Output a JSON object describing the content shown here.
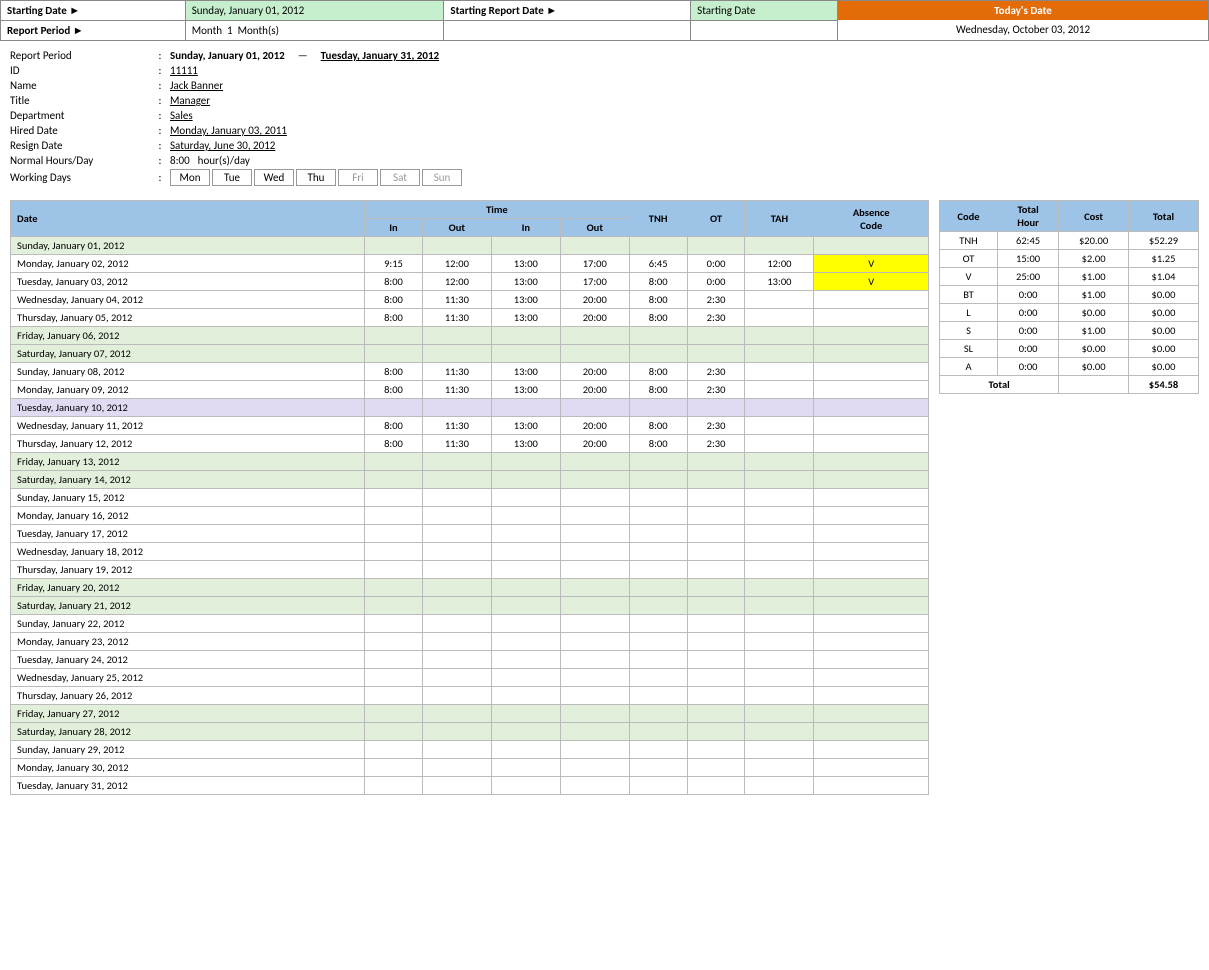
{
  "header": {
    "starting_date_label": "Starting Date ►",
    "starting_date_value": "Sunday, January 01, 2012",
    "starting_report_date_label": "Starting Report Date ►",
    "starting_report_date_value": "Starting Date",
    "report_period_label": "Report Period ►",
    "report_period_month": "Month",
    "report_period_num": "1",
    "report_period_unit": "Month(s)",
    "todays_date_header": "Today's Date",
    "todays_date_value": "Wednesday, October 03, 2012"
  },
  "info": {
    "report_period_label": "Report Period",
    "report_period_start": "Sunday, January 01, 2012",
    "report_period_end": "Tuesday, January 31, 2012",
    "id_label": "ID",
    "id_value": "11111",
    "name_label": "Name",
    "name_value": "Jack Banner",
    "title_label": "Title",
    "title_value": "Manager",
    "department_label": "Department",
    "department_value": "Sales",
    "hired_date_label": "Hired Date",
    "hired_date_value": "Monday, January 03, 2011",
    "resign_date_label": "Resign Date",
    "resign_date_value": "Saturday, June 30, 2012",
    "normal_hours_label": "Normal Hours/Day",
    "normal_hours_value": "8:00",
    "normal_hours_unit": "hour(s)/day",
    "working_days_label": "Working Days",
    "working_days": [
      "Mon",
      "Tue",
      "Wed",
      "Thu",
      "Fri",
      "Sat",
      "Sun"
    ],
    "working_days_active": [
      true,
      true,
      true,
      true,
      false,
      false,
      false
    ]
  },
  "table": {
    "headers": {
      "date": "Date",
      "time": "Time",
      "tnh": "TNH",
      "ot": "OT",
      "tah": "TAH",
      "absence_code": "Absence Code",
      "time_in1": "In",
      "time_out1": "Out",
      "time_in2": "In",
      "time_out2": "Out"
    },
    "rows": [
      {
        "date": "Sunday, January 01, 2012",
        "type": "sunday",
        "in1": "",
        "out1": "",
        "in2": "",
        "out2": "",
        "tnh": "",
        "ot": "",
        "tah": "",
        "absence": ""
      },
      {
        "date": "Monday, January 02, 2012",
        "type": "normal",
        "in1": "9:15",
        "out1": "12:00",
        "in2": "13:00",
        "out2": "17:00",
        "tnh": "6:45",
        "ot": "0:00",
        "tah": "12:00",
        "absence": "V",
        "absence_yellow": true
      },
      {
        "date": "Tuesday, January 03, 2012",
        "type": "normal",
        "in1": "8:00",
        "out1": "12:00",
        "in2": "13:00",
        "out2": "17:00",
        "tnh": "8:00",
        "ot": "0:00",
        "tah": "13:00",
        "absence": "V",
        "absence_yellow": true
      },
      {
        "date": "Wednesday, January 04, 2012",
        "type": "normal",
        "in1": "8:00",
        "out1": "11:30",
        "in2": "13:00",
        "out2": "20:00",
        "tnh": "8:00",
        "ot": "2:30",
        "tah": "",
        "absence": ""
      },
      {
        "date": "Thursday, January 05, 2012",
        "type": "normal",
        "in1": "8:00",
        "out1": "11:30",
        "in2": "13:00",
        "out2": "20:00",
        "tnh": "8:00",
        "ot": "2:30",
        "tah": "",
        "absence": ""
      },
      {
        "date": "Friday, January 06, 2012",
        "type": "saturday",
        "in1": "",
        "out1": "",
        "in2": "",
        "out2": "",
        "tnh": "",
        "ot": "",
        "tah": "",
        "absence": ""
      },
      {
        "date": "Saturday, January 07, 2012",
        "type": "saturday",
        "in1": "",
        "out1": "",
        "in2": "",
        "out2": "",
        "tnh": "",
        "ot": "",
        "tah": "",
        "absence": ""
      },
      {
        "date": "Sunday, January 08, 2012",
        "type": "normal",
        "in1": "8:00",
        "out1": "11:30",
        "in2": "13:00",
        "out2": "20:00",
        "tnh": "8:00",
        "ot": "2:30",
        "tah": "",
        "absence": ""
      },
      {
        "date": "Monday, January 09, 2012",
        "type": "normal",
        "in1": "8:00",
        "out1": "11:30",
        "in2": "13:00",
        "out2": "20:00",
        "tnh": "8:00",
        "ot": "2:30",
        "tah": "",
        "absence": ""
      },
      {
        "date": "Tuesday, January 10, 2012",
        "type": "special",
        "in1": "",
        "out1": "",
        "in2": "",
        "out2": "",
        "tnh": "",
        "ot": "",
        "tah": "",
        "absence": ""
      },
      {
        "date": "Wednesday, January 11, 2012",
        "type": "normal",
        "in1": "8:00",
        "out1": "11:30",
        "in2": "13:00",
        "out2": "20:00",
        "tnh": "8:00",
        "ot": "2:30",
        "tah": "",
        "absence": ""
      },
      {
        "date": "Thursday, January 12, 2012",
        "type": "normal",
        "in1": "8:00",
        "out1": "11:30",
        "in2": "13:00",
        "out2": "20:00",
        "tnh": "8:00",
        "ot": "2:30",
        "tah": "",
        "absence": ""
      },
      {
        "date": "Friday, January 13, 2012",
        "type": "saturday",
        "in1": "",
        "out1": "",
        "in2": "",
        "out2": "",
        "tnh": "",
        "ot": "",
        "tah": "",
        "absence": ""
      },
      {
        "date": "Saturday, January 14, 2012",
        "type": "saturday",
        "in1": "",
        "out1": "",
        "in2": "",
        "out2": "",
        "tnh": "",
        "ot": "",
        "tah": "",
        "absence": ""
      },
      {
        "date": "Sunday, January 15, 2012",
        "type": "normal",
        "in1": "",
        "out1": "",
        "in2": "",
        "out2": "",
        "tnh": "",
        "ot": "",
        "tah": "",
        "absence": ""
      },
      {
        "date": "Monday, January 16, 2012",
        "type": "normal",
        "in1": "",
        "out1": "",
        "in2": "",
        "out2": "",
        "tnh": "",
        "ot": "",
        "tah": "",
        "absence": ""
      },
      {
        "date": "Tuesday, January 17, 2012",
        "type": "normal",
        "in1": "",
        "out1": "",
        "in2": "",
        "out2": "",
        "tnh": "",
        "ot": "",
        "tah": "",
        "absence": ""
      },
      {
        "date": "Wednesday, January 18, 2012",
        "type": "normal",
        "in1": "",
        "out1": "",
        "in2": "",
        "out2": "",
        "tnh": "",
        "ot": "",
        "tah": "",
        "absence": ""
      },
      {
        "date": "Thursday, January 19, 2012",
        "type": "normal",
        "in1": "",
        "out1": "",
        "in2": "",
        "out2": "",
        "tnh": "",
        "ot": "",
        "tah": "",
        "absence": ""
      },
      {
        "date": "Friday, January 20, 2012",
        "type": "saturday",
        "in1": "",
        "out1": "",
        "in2": "",
        "out2": "",
        "tnh": "",
        "ot": "",
        "tah": "",
        "absence": ""
      },
      {
        "date": "Saturday, January 21, 2012",
        "type": "saturday",
        "in1": "",
        "out1": "",
        "in2": "",
        "out2": "",
        "tnh": "",
        "ot": "",
        "tah": "",
        "absence": ""
      },
      {
        "date": "Sunday, January 22, 2012",
        "type": "normal",
        "in1": "",
        "out1": "",
        "in2": "",
        "out2": "",
        "tnh": "",
        "ot": "",
        "tah": "",
        "absence": ""
      },
      {
        "date": "Monday, January 23, 2012",
        "type": "normal",
        "in1": "",
        "out1": "",
        "in2": "",
        "out2": "",
        "tnh": "",
        "ot": "",
        "tah": "",
        "absence": ""
      },
      {
        "date": "Tuesday, January 24, 2012",
        "type": "normal",
        "in1": "",
        "out1": "",
        "in2": "",
        "out2": "",
        "tnh": "",
        "ot": "",
        "tah": "",
        "absence": ""
      },
      {
        "date": "Wednesday, January 25, 2012",
        "type": "normal",
        "in1": "",
        "out1": "",
        "in2": "",
        "out2": "",
        "tnh": "",
        "ot": "",
        "tah": "",
        "absence": ""
      },
      {
        "date": "Thursday, January 26, 2012",
        "type": "normal",
        "in1": "",
        "out1": "",
        "in2": "",
        "out2": "",
        "tnh": "",
        "ot": "",
        "tah": "",
        "absence": ""
      },
      {
        "date": "Friday, January 27, 2012",
        "type": "saturday",
        "in1": "",
        "out1": "",
        "in2": "",
        "out2": "",
        "tnh": "",
        "ot": "",
        "tah": "",
        "absence": ""
      },
      {
        "date": "Saturday, January 28, 2012",
        "type": "saturday",
        "in1": "",
        "out1": "",
        "in2": "",
        "out2": "",
        "tnh": "",
        "ot": "",
        "tah": "",
        "absence": ""
      },
      {
        "date": "Sunday, January 29, 2012",
        "type": "normal",
        "in1": "",
        "out1": "",
        "in2": "",
        "out2": "",
        "tnh": "",
        "ot": "",
        "tah": "",
        "absence": ""
      },
      {
        "date": "Monday, January 30, 2012",
        "type": "normal",
        "in1": "",
        "out1": "",
        "in2": "",
        "out2": "",
        "tnh": "",
        "ot": "",
        "tah": "",
        "absence": ""
      },
      {
        "date": "Tuesday, January 31, 2012",
        "type": "normal",
        "in1": "",
        "out1": "",
        "in2": "",
        "out2": "",
        "tnh": "",
        "ot": "",
        "tah": "",
        "absence": ""
      }
    ]
  },
  "summary": {
    "headers": [
      "Code",
      "Total Hour",
      "Cost",
      "Total"
    ],
    "rows": [
      {
        "code": "TNH",
        "total_hour": "62:45",
        "cost": "$20.00",
        "total": "$52.29"
      },
      {
        "code": "OT",
        "total_hour": "15:00",
        "cost": "$2.00",
        "total": "$1.25"
      },
      {
        "code": "V",
        "total_hour": "25:00",
        "cost": "$1.00",
        "total": "$1.04"
      },
      {
        "code": "BT",
        "total_hour": "0:00",
        "cost": "$1.00",
        "total": "$0.00"
      },
      {
        "code": "L",
        "total_hour": "0:00",
        "cost": "$0.00",
        "total": "$0.00"
      },
      {
        "code": "S",
        "total_hour": "0:00",
        "cost": "$1.00",
        "total": "$0.00"
      },
      {
        "code": "SL",
        "total_hour": "0:00",
        "cost": "$0.00",
        "total": "$0.00"
      },
      {
        "code": "A",
        "total_hour": "0:00",
        "cost": "$0.00",
        "total": "$0.00"
      }
    ],
    "total_label": "Total",
    "grand_total": "$54.58"
  }
}
